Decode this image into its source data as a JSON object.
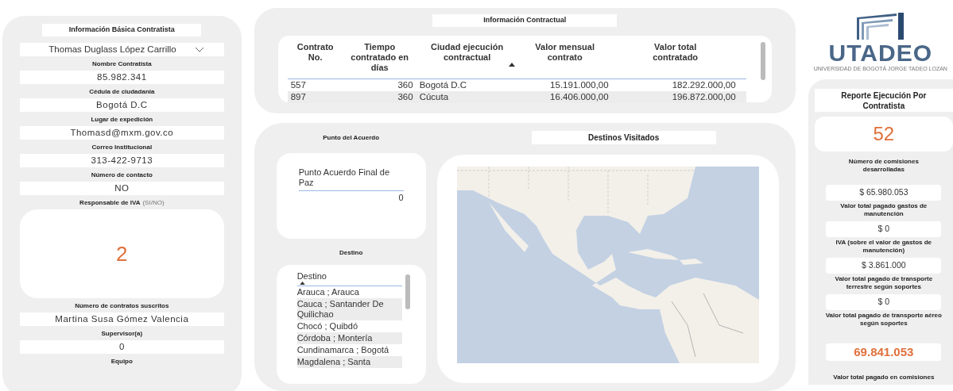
{
  "contractor_panel": {
    "title": "Información Básica Contratista",
    "fields": [
      {
        "kind": "dropdown",
        "value": "Thomas Duglass López Carrillo",
        "label": "Nombre Contratista"
      },
      {
        "kind": "text",
        "value": "85.982.341",
        "label": "Cédula de ciudadania"
      },
      {
        "kind": "text",
        "value": "Bogotá D.C",
        "label": "Lugar de expedición"
      },
      {
        "kind": "text",
        "value": "Thomasd@mxm.gov.co",
        "label": "Correo Institucional"
      },
      {
        "kind": "text",
        "value": "313-422-9713",
        "label": "Número de contacto"
      },
      {
        "kind": "text",
        "value": "NO",
        "label": "Responsable de IVA",
        "note": "(SI/NO)"
      },
      {
        "kind": "card",
        "value": "2",
        "label": "Número de contratos suscritos"
      },
      {
        "kind": "text",
        "value": "Martina Susa Gómez Valencia",
        "label": "Supervisor(a)"
      },
      {
        "kind": "text",
        "value": "0",
        "label": "Equipo"
      }
    ]
  },
  "contract_panel": {
    "title": "Información Contractual",
    "table": {
      "columns": [
        {
          "label": "Contrato No.",
          "sorted": false
        },
        {
          "label": "Tiempo contratado en días",
          "sorted": false
        },
        {
          "label": "Ciudad ejecución contractual",
          "sorted": true
        },
        {
          "label": "Valor mensual contrato",
          "sorted": false
        },
        {
          "label": "Valor total contratado",
          "sorted": false
        }
      ],
      "rows": [
        [
          "557",
          "360",
          "Bogotá D.C",
          "15.191.000,00",
          "182.292.000,00"
        ],
        [
          "897",
          "360",
          "Cúcuta",
          "16.406.000,00",
          "196.872.000,00"
        ]
      ]
    }
  },
  "agreement": {
    "title": "Punto del Acuerdo",
    "header": "Punto Acuerdo Final de Paz",
    "value": "0"
  },
  "destination": {
    "title": "Destino",
    "header": "Destino",
    "sorted": true,
    "items": [
      "Arauca ; Arauca",
      "Cauca ; Santander De Quilichao",
      "Chocó ; Quibdó",
      "Córdoba ; Montería",
      "Cundinamarca ; Bogotá",
      "Magdalena ; Santa"
    ]
  },
  "map": {
    "title": "Destinos Visitados",
    "kind": "picture"
  },
  "logo": {
    "name": "UTADEO",
    "subtitle": "UNIVERSIDAD DE BOGOTÁ JORGE TADEO LOZAN"
  },
  "report": {
    "title": "Reporte Ejecución Por Contratista",
    "count": "52",
    "count_label": "Número de comisiones desarrolladas",
    "items": [
      {
        "value": "$ 65.980.053",
        "label": "Valor total pagado gastos de manutención"
      },
      {
        "value": "$ 0",
        "label": "IVA (sobre el valor de gastos de manutención)"
      },
      {
        "value": "$ 3.861.000",
        "label": "Valor total pagado de transporte terrestre según soportes"
      },
      {
        "value": "$ 0",
        "label": "Valor total pagado de transporte aéreo según soportes"
      }
    ],
    "total": "69.841.053",
    "total_label": "Valor total pagado en comisiones"
  }
}
